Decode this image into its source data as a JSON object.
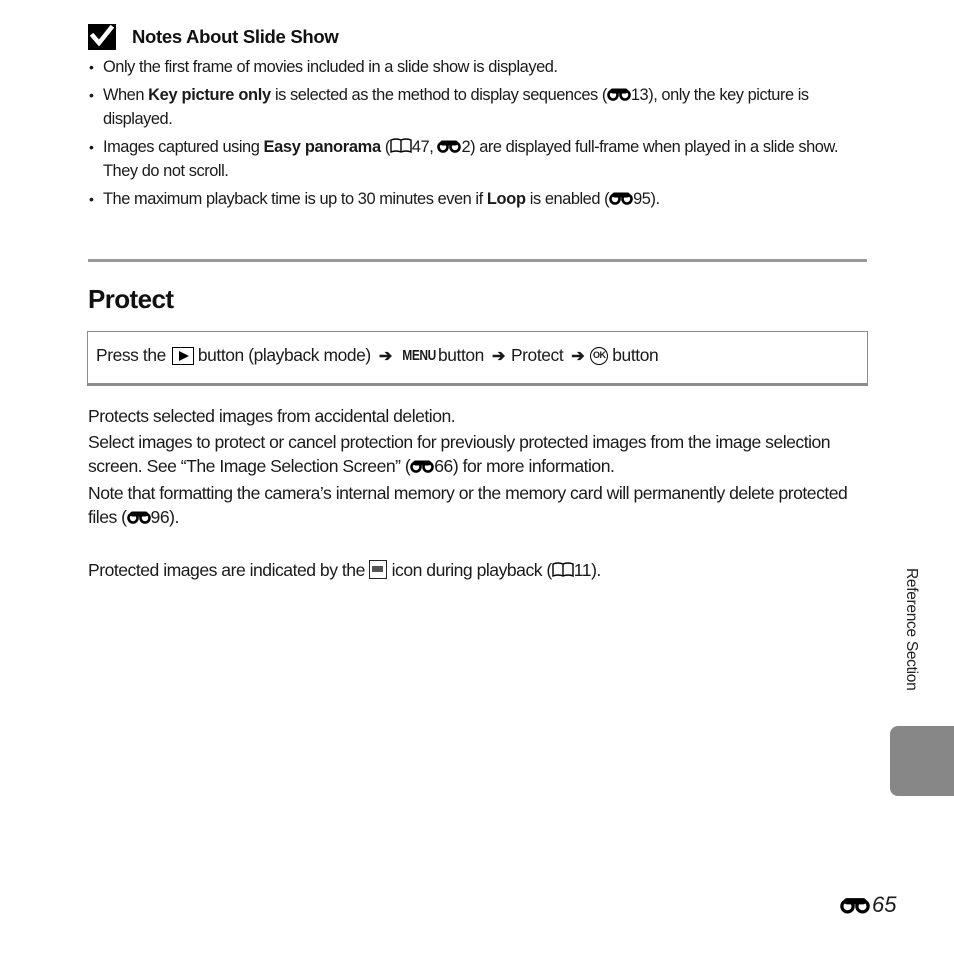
{
  "notes": {
    "icon": "checkmark-icon",
    "title": "Notes About Slide Show",
    "items": [
      {
        "parts": [
          {
            "t": "Only the first frame of movies included in a slide show is displayed."
          }
        ]
      },
      {
        "parts": [
          {
            "t": "When "
          },
          {
            "t": "Key picture only",
            "b": true
          },
          {
            "t": " is selected as the method to display sequences ("
          },
          {
            "ref": "reference-section-icon",
            "t": "13"
          },
          {
            "t": "), only the key picture is displayed."
          }
        ]
      },
      {
        "parts": [
          {
            "t": "Images captured using "
          },
          {
            "t": "Easy panorama",
            "b": true
          },
          {
            "t": " ("
          },
          {
            "book": "book-icon",
            "t": "47"
          },
          {
            "t": ", "
          },
          {
            "ref": "reference-section-icon",
            "t": "2"
          },
          {
            "t": ") are displayed full-frame when played in a slide show. They do not scroll."
          }
        ]
      },
      {
        "parts": [
          {
            "t": "The maximum playback time is up to 30 minutes even if "
          },
          {
            "t": "Loop",
            "b": true
          },
          {
            "t": " is enabled ("
          },
          {
            "ref": "reference-section-icon",
            "t": "95"
          },
          {
            "t": ")."
          }
        ]
      }
    ]
  },
  "section": {
    "title": "Protect",
    "procedure": {
      "press_the": "Press the",
      "playback_icon": "playback-button-icon",
      "button_playback_mode": "button (playback mode)",
      "arrow": "➔",
      "menu_label": "MENU",
      "button": "button",
      "protect": "Protect",
      "ok_label": "OK"
    },
    "paragraphs": {
      "p1": "Protects selected images from accidental deletion.",
      "p2_a": "Select images to protect or cancel protection for previously protected images from the image selection screen. See “The Image Selection Screen” (",
      "p2_ref": "66",
      "p2_b": ") for more information.",
      "p3_a": "Note that formatting the camera’s internal memory or the memory card will permanently delete protected files (",
      "p3_ref": "96",
      "p3_b": ").",
      "p4_a": "Protected images are indicated by the ",
      "p4_b": " icon during playback (",
      "p4_ref": "11",
      "p4_c": ")."
    }
  },
  "sidebar": {
    "label": "Reference Section",
    "tab_color": "#878787"
  },
  "page": {
    "number": "65",
    "prefix_icon": "reference-section-icon"
  }
}
